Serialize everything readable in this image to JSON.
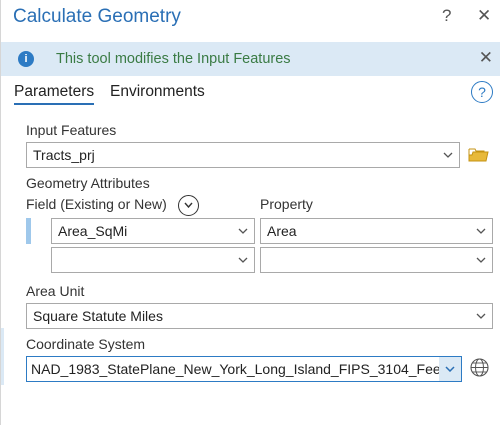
{
  "header": {
    "title": "Calculate Geometry",
    "help": "?",
    "close": "✕"
  },
  "info": {
    "text": "This tool modifies the Input Features"
  },
  "tabs": [
    {
      "label": "Parameters"
    },
    {
      "label": "Environments"
    }
  ],
  "input_features": {
    "label": "Input Features",
    "value": "Tracts_prj"
  },
  "geometry_attributes": {
    "label": "Geometry Attributes",
    "field_header": "Field (Existing or New)",
    "property_header": "Property",
    "rows": [
      {
        "field": "Area_SqMi",
        "property": "Area"
      },
      {
        "field": "",
        "property": ""
      }
    ]
  },
  "area_unit": {
    "label": "Area Unit",
    "value": "Square Statute Miles"
  },
  "coordinate_system": {
    "label": "Coordinate System",
    "value": "NAD_1983_StatePlane_New_York_Long_Island_FIPS_3104_Fee"
  },
  "colors": {
    "accent": "#2a6fb5",
    "info_bg": "#dbe9f5",
    "info_text": "#3a7b44"
  }
}
